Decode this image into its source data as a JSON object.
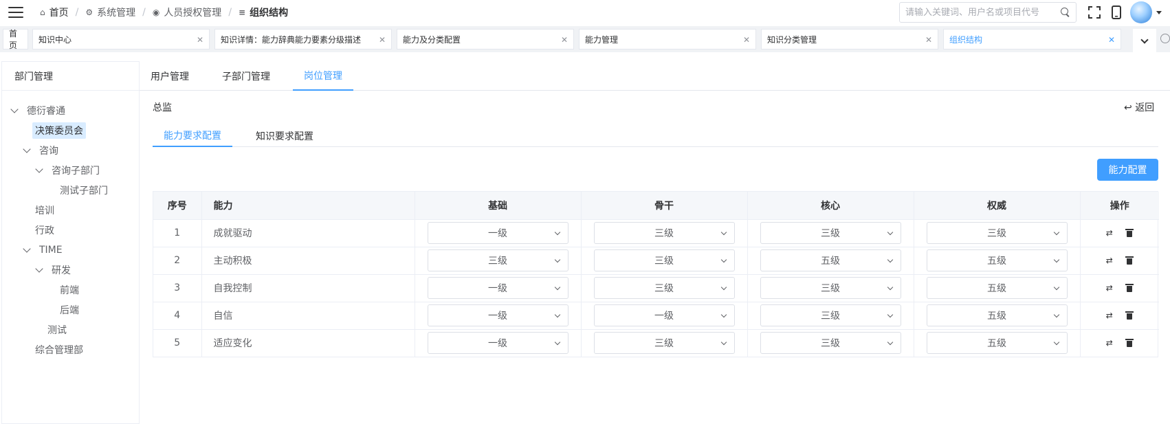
{
  "breadcrumb": [
    {
      "label": "首页",
      "icon": "home-icon"
    },
    {
      "label": "系统管理",
      "icon": "gear-icon"
    },
    {
      "label": "人员授权管理",
      "icon": "user-circle-icon"
    },
    {
      "label": "组织结构",
      "icon": "list-icon"
    }
  ],
  "search": {
    "placeholder": "请输入关键词、用户名或项目代号",
    "value": ""
  },
  "tags": [
    {
      "label": "首页"
    },
    {
      "label": "知识中心"
    },
    {
      "label": "知识详情：能力辞典能力要素分级描述"
    },
    {
      "label": "能力及分类配置"
    },
    {
      "label": "能力管理"
    },
    {
      "label": "知识分类管理"
    },
    {
      "label": "组织结构"
    }
  ],
  "left": {
    "title": "部门管理",
    "tree": [
      {
        "label": "德衍睿通",
        "expanded": true
      },
      {
        "label": "决策委员会",
        "selected": true
      },
      {
        "label": "咨询",
        "expanded": true
      },
      {
        "label": "咨询子部门",
        "expanded": true
      },
      {
        "label": "测试子部门"
      },
      {
        "label": "培训"
      },
      {
        "label": "行政"
      },
      {
        "label": "TIME",
        "expanded": true
      },
      {
        "label": "研发",
        "expanded": true
      },
      {
        "label": "前端"
      },
      {
        "label": "后端"
      },
      {
        "label": "测试"
      },
      {
        "label": "综合管理部"
      }
    ]
  },
  "main": {
    "tabs": [
      "用户管理",
      "子部门管理",
      "岗位管理"
    ],
    "active_tab": "岗位管理",
    "role_title": "总监",
    "back_label": "返回",
    "sub_tabs": [
      "能力要求配置",
      "知识要求配置"
    ],
    "active_sub_tab": "能力要求配置",
    "config_button": "能力配置",
    "table": {
      "headers": [
        "序号",
        "能力",
        "基础",
        "骨干",
        "核心",
        "权威",
        "操作"
      ],
      "rows": [
        {
          "index": "1",
          "ability": "成就驱动",
          "basic": "一级",
          "backbone": "三级",
          "core": "三级",
          "authority": "三级"
        },
        {
          "index": "2",
          "ability": "主动积极",
          "basic": "三级",
          "backbone": "三级",
          "core": "五级",
          "authority": "五级"
        },
        {
          "index": "3",
          "ability": "自我控制",
          "basic": "一级",
          "backbone": "三级",
          "core": "三级",
          "authority": "五级"
        },
        {
          "index": "4",
          "ability": "自信",
          "basic": "一级",
          "backbone": "一级",
          "core": "三级",
          "authority": "五级"
        },
        {
          "index": "5",
          "ability": "适应变化",
          "basic": "一级",
          "backbone": "三级",
          "core": "三级",
          "authority": "五级"
        }
      ]
    }
  }
}
